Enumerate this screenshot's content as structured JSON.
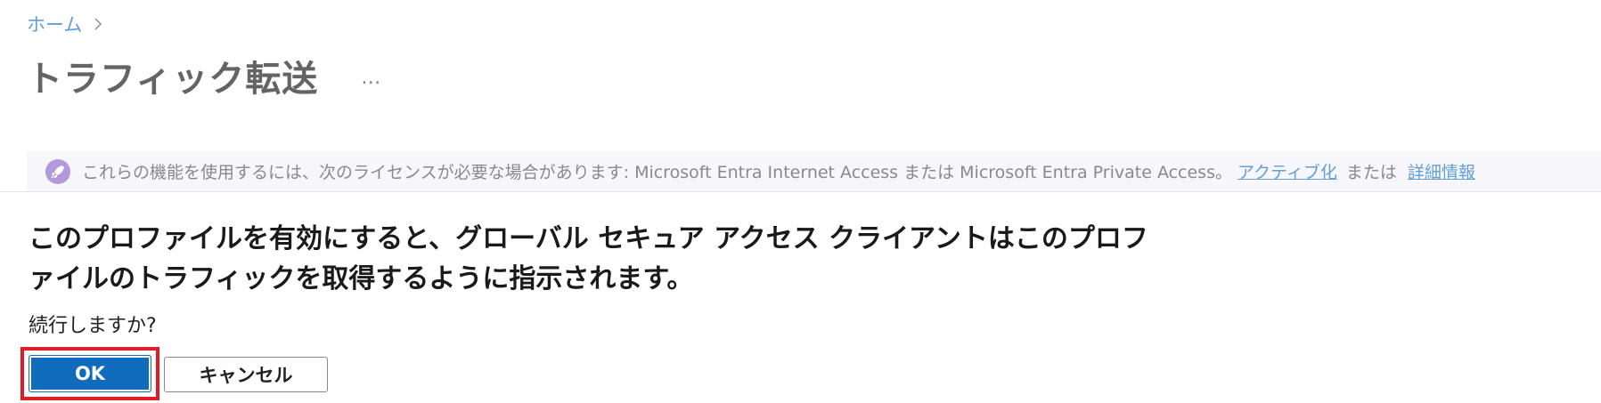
{
  "breadcrumb": {
    "home_label": "ホーム"
  },
  "page": {
    "title": "トラフィック転送",
    "more_label": "…"
  },
  "banner": {
    "text": "これらの機能を使用するには、次のライセンスが必要な場合があります: Microsoft Entra Internet Access または Microsoft Entra Private Access。",
    "activate_link": "アクティブ化",
    "or_text": "または",
    "details_link": "詳細情報"
  },
  "dialog": {
    "message": "このプロファイルを有効にすると、グローバル セキュア アクセス クライアントはこのプロファイルのトラフィックを取得するように指示されます。",
    "question": "続行しますか?",
    "ok_label": "OK",
    "cancel_label": "キャンセル"
  },
  "colors": {
    "accent": "#0f6cbd",
    "highlight": "#e01c24",
    "banner_bg": "#f3f2f7"
  }
}
